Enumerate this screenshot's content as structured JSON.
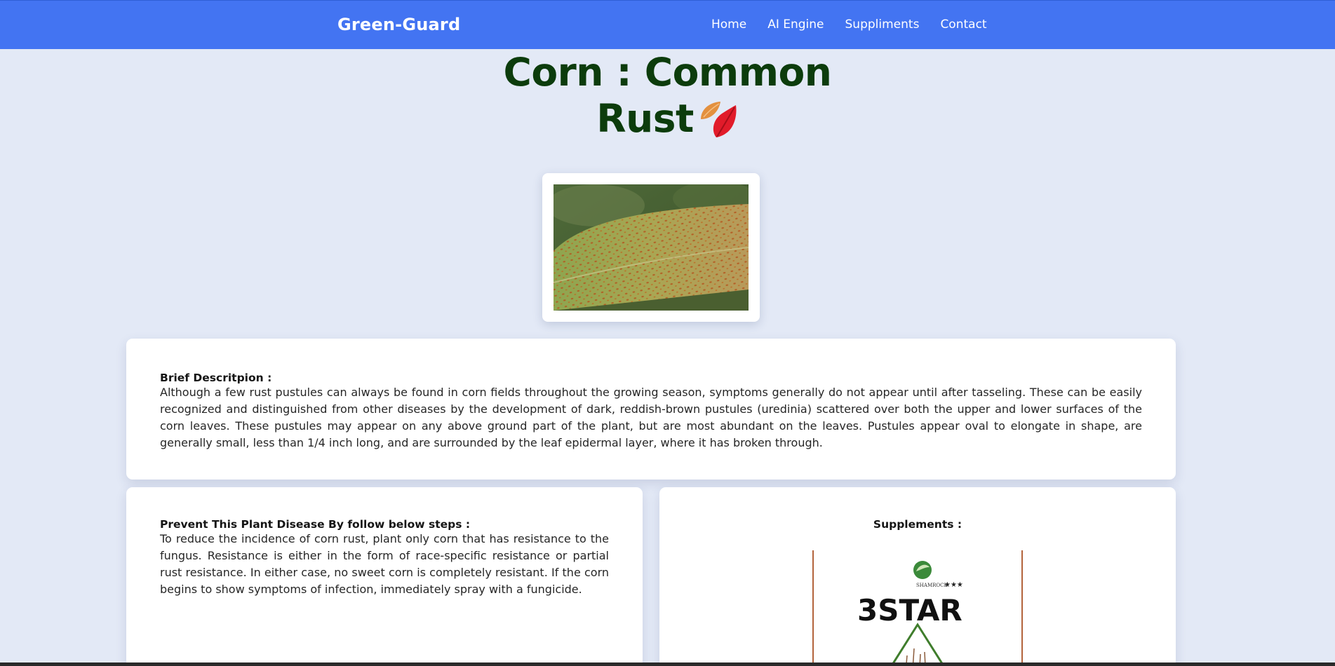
{
  "navbar": {
    "brand": "Green-Guard",
    "links": [
      {
        "label": "Home"
      },
      {
        "label": "AI Engine"
      },
      {
        "label": "Suppliments"
      },
      {
        "label": "Contact"
      }
    ]
  },
  "page": {
    "title_line1": "Corn : Common",
    "title_line2": "Rust",
    "title_icon": "autumn-leaves-icon"
  },
  "description": {
    "heading": "Brief Descritpion :",
    "text": "Although a few rust pustules can always be found in corn fields throughout the growing season, symptoms generally do not appear until after tasseling. These can be easily recognized and distinguished from other diseases by the development of dark, reddish-brown pustules (uredinia) scattered over both the upper and lower surfaces of the corn leaves. These pustules may appear on any above ground part of the plant, but are most abundant on the leaves. Pustules appear oval to elongate in shape, are generally small, less than 1/4 inch long, and are surrounded by the leaf epidermal layer, where it has broken through."
  },
  "prevention": {
    "heading": "Prevent This Plant Disease By follow below steps :",
    "text": "To reduce the incidence of corn rust, plant only corn that has resistance to the fungus. Resistance is either in the form of race-specific resistance or partial rust resistance. In either case, no sweet corn is completely resistant. If the corn begins to show symptoms of infection, immediately spray with a fungicide."
  },
  "supplements": {
    "heading": "Supplements :",
    "product_logo_text": "SHAMROCK",
    "product_name": "3STAR"
  },
  "colors": {
    "navbar": "#4374f2",
    "background": "#e3e9f6",
    "title": "#0c3c0c"
  }
}
